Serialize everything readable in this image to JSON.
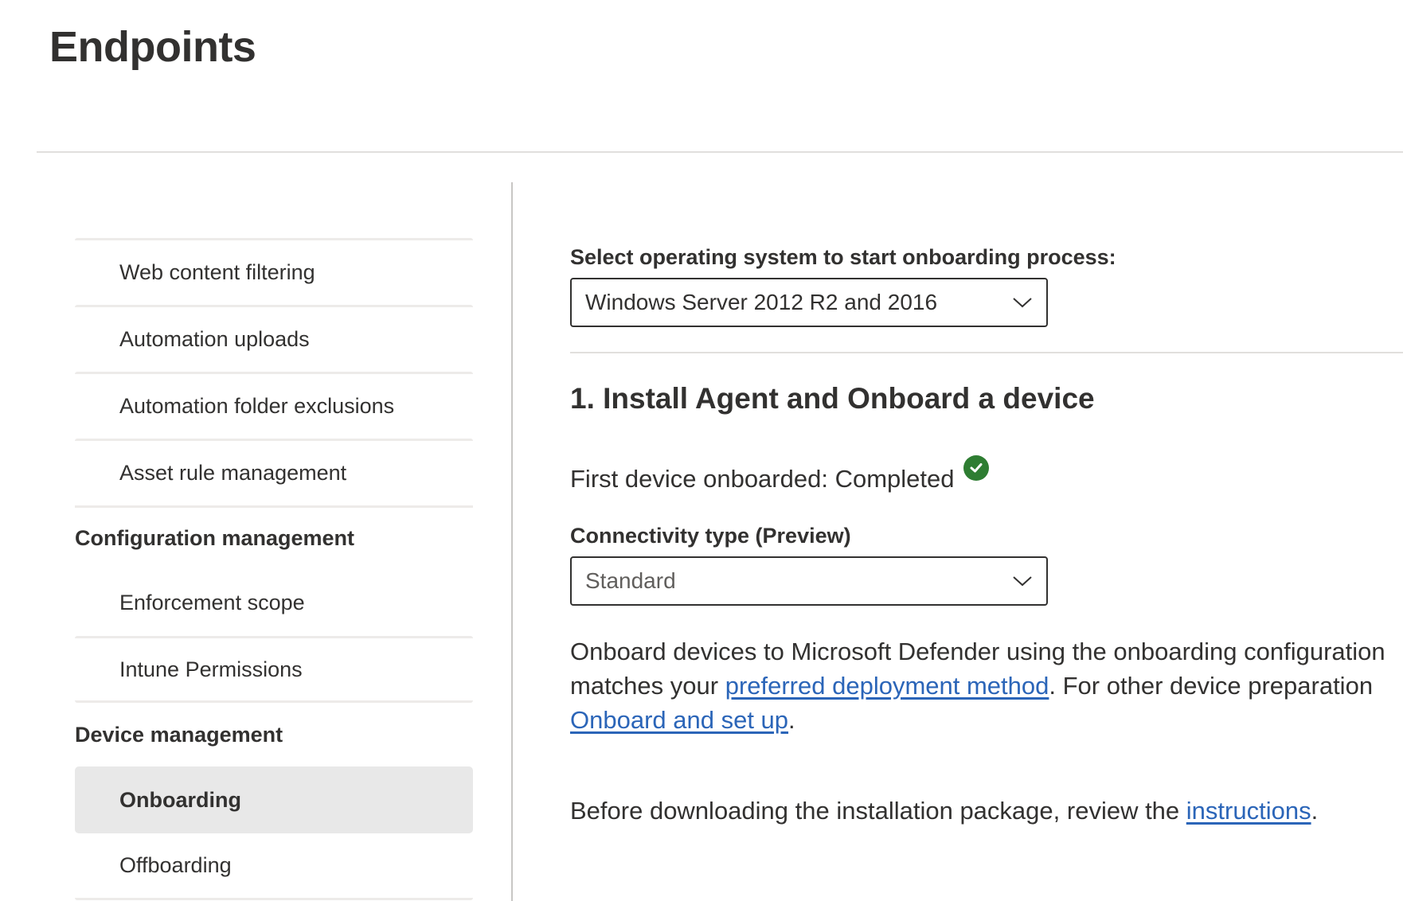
{
  "page": {
    "title": "Endpoints"
  },
  "sidebar": {
    "items_top": [
      {
        "label": "Web content filtering"
      },
      {
        "label": "Automation uploads"
      },
      {
        "label": "Automation folder exclusions"
      },
      {
        "label": "Asset rule management"
      }
    ],
    "groups": [
      {
        "title": "Configuration management",
        "items": [
          {
            "label": "Enforcement scope"
          },
          {
            "label": "Intune Permissions"
          }
        ]
      },
      {
        "title": "Device management",
        "items": [
          {
            "label": "Onboarding",
            "selected": true
          },
          {
            "label": "Offboarding"
          }
        ]
      }
    ]
  },
  "content": {
    "os_label": "Select operating system to start onboarding process:",
    "os_selected": "Windows Server 2012 R2 and 2016",
    "step_heading": "1. Install Agent and Onboard a device",
    "status_text": "First device onboarded: Completed",
    "status_icon": "check-circle-icon",
    "status_color": "#2e7d32",
    "connectivity_label": "Connectivity type (Preview)",
    "connectivity_selected": "Standard",
    "para1": {
      "line1": "Onboard devices to Microsoft Defender using the onboarding configuration",
      "line2_pre": "matches your ",
      "link1": "preferred deployment method",
      "line2_post": ". For other device preparation",
      "link2": "Onboard and set up",
      "line3_post": "."
    },
    "para2": {
      "pre": "Before downloading the installation package, review the ",
      "link": "instructions",
      "post": "."
    },
    "link_color": "#2b65b8"
  }
}
